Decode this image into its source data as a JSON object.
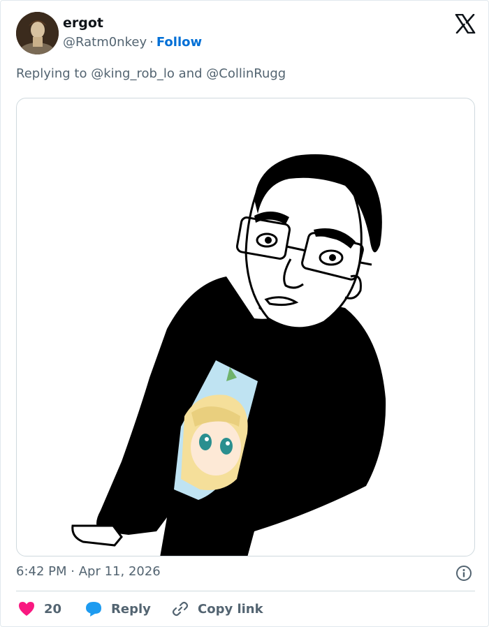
{
  "user": {
    "name": "ergot",
    "handle": "@Ratm0nkey",
    "separator": "·",
    "follow_label": "Follow"
  },
  "reply_context": {
    "prefix": "Replying to",
    "mention1": "@king_rob_lo",
    "conjunction": "and",
    "mention2": "@CollinRugg"
  },
  "timestamp": {
    "time": "6:42 PM",
    "separator": "·",
    "date": "Apr 11, 2026"
  },
  "actions": {
    "like_count": "20",
    "reply_label": "Reply",
    "copy_link_label": "Copy link"
  },
  "colors": {
    "like": "#f91880",
    "reply": "#1d9bf0",
    "follow": "#006fd6",
    "muted": "#536471"
  },
  "icons": [
    "x-logo-icon",
    "info-icon",
    "heart-icon",
    "reply-bubble-icon",
    "link-icon"
  ]
}
